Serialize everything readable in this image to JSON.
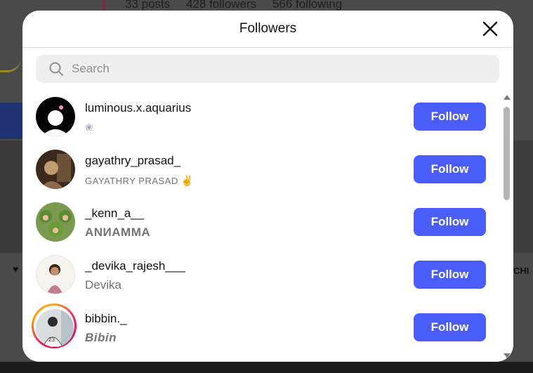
{
  "background": {
    "stats": [
      "33 posts",
      "428 followers",
      "566 following"
    ],
    "right_text": "CHI"
  },
  "modal": {
    "title": "Followers",
    "close_icon": "close-icon",
    "search": {
      "placeholder": "Search",
      "value": ""
    }
  },
  "followers": [
    {
      "username": "luminous.x.aquarius",
      "fullname": "",
      "has_emoji": true,
      "button": "Follow"
    },
    {
      "username": "gayathry_prasad_",
      "fullname": "GAYATHRY PRASAD",
      "has_emoji": true,
      "button": "Follow"
    },
    {
      "username": "_kenn_a__",
      "fullname": "ANИAMMA",
      "has_emoji": false,
      "button": "Follow"
    },
    {
      "username": "_devika_rajesh___",
      "fullname": "Devika",
      "has_emoji": false,
      "button": "Follow"
    },
    {
      "username": "bibbin._",
      "fullname": "Bibin",
      "has_emoji": false,
      "has_story": true,
      "button": "Follow"
    }
  ],
  "colors": {
    "follow_button": "#4a5df9",
    "story_ring": "#e91e63"
  }
}
